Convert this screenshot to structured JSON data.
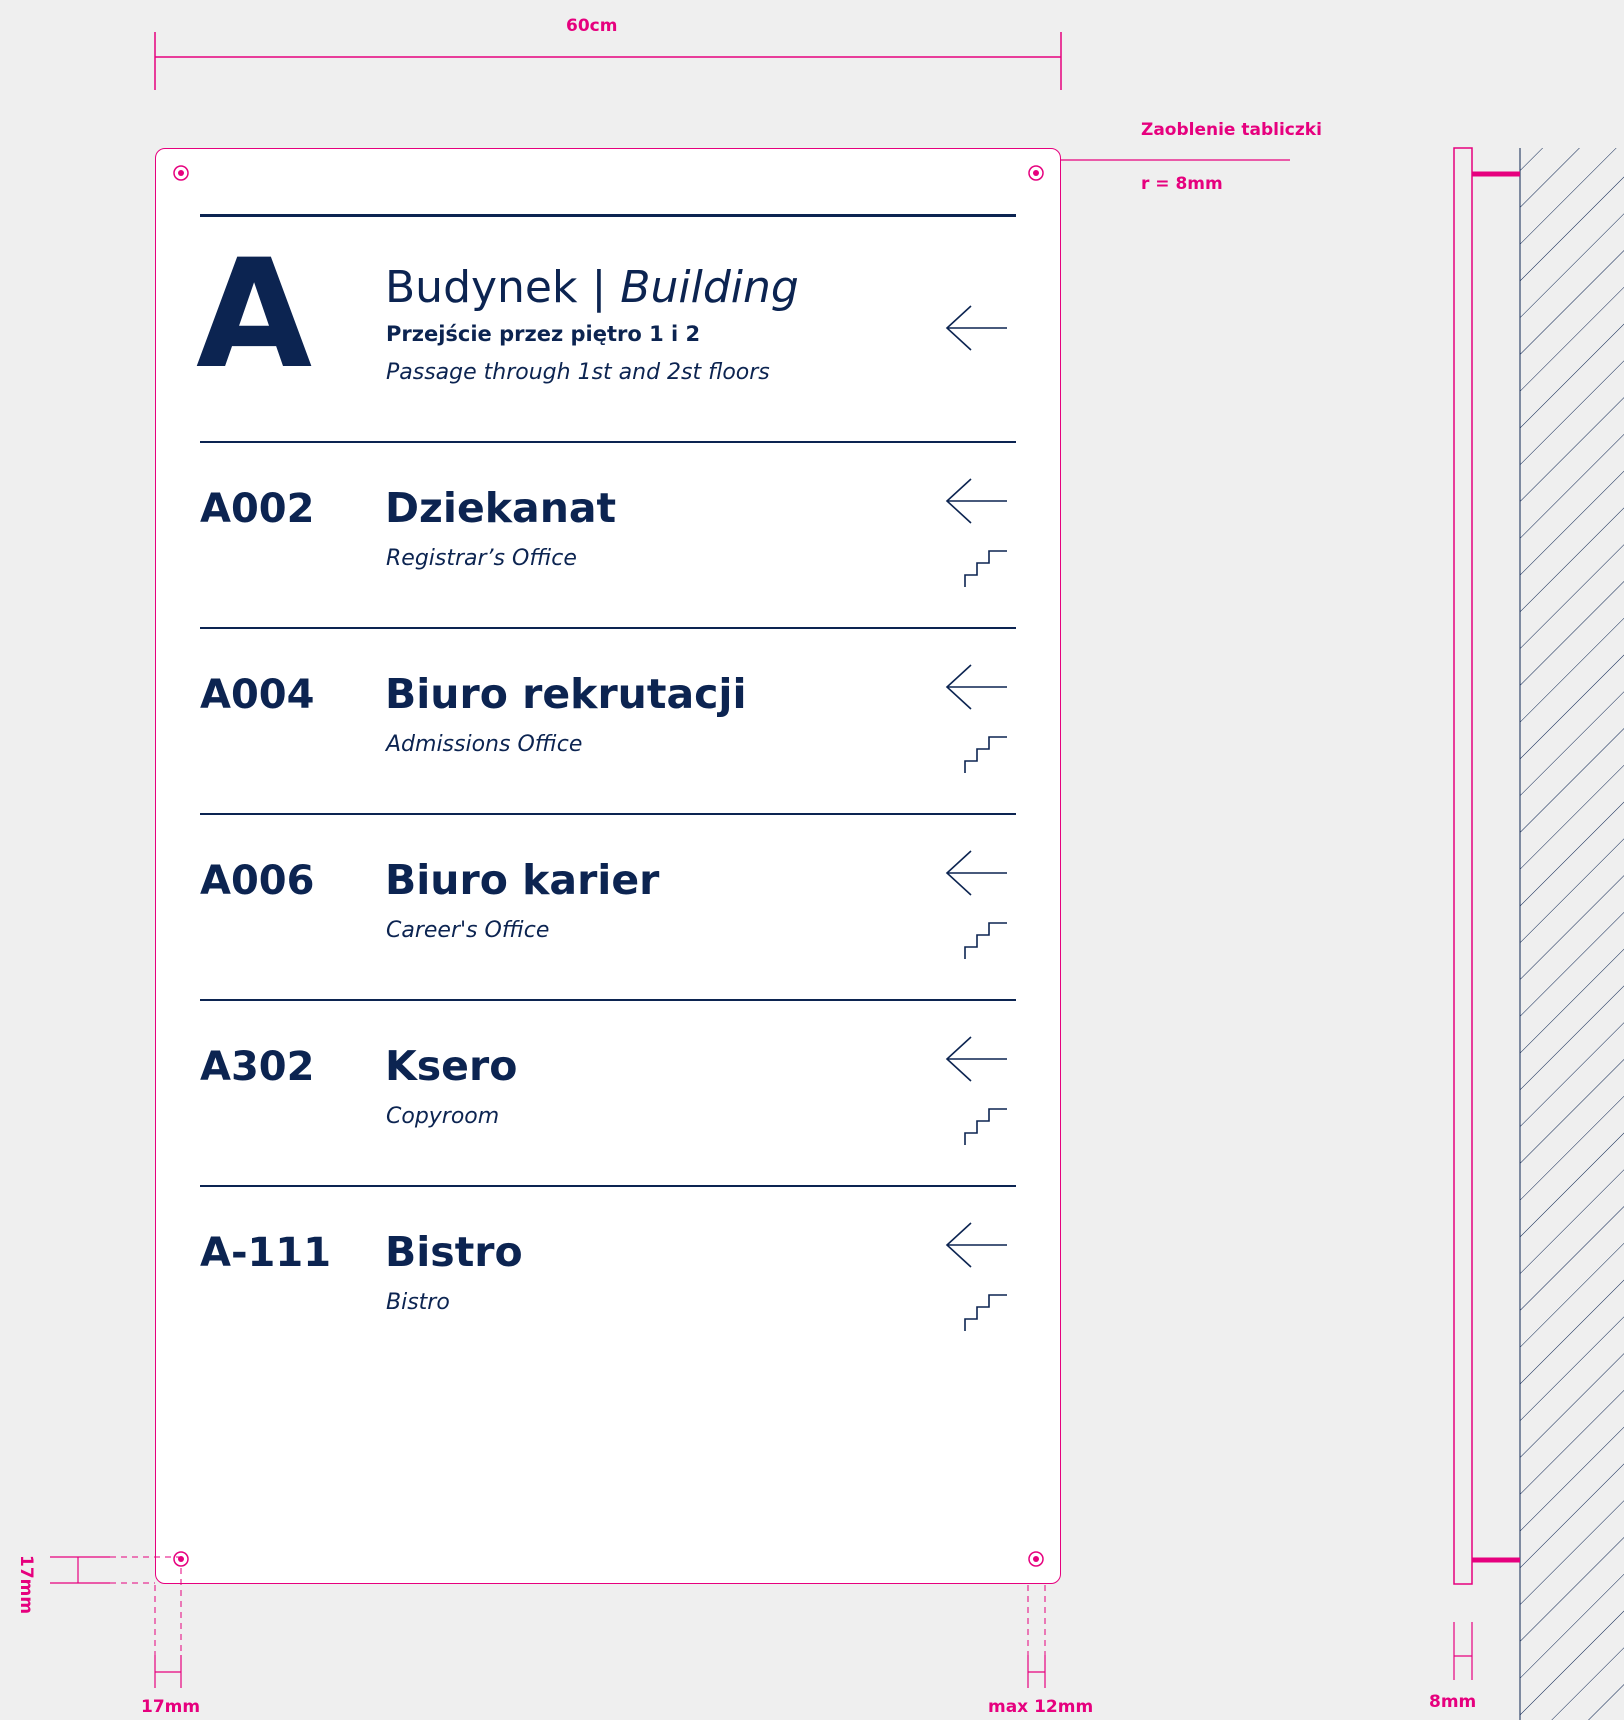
{
  "dimensions": {
    "width_label": "60cm",
    "corner_label": "Zaoblenie tabliczki",
    "corner_radius": "r = 8mm",
    "left_margin_horizontal": "17mm",
    "left_margin_vertical": "17mm",
    "right_margin": "max 12mm",
    "depth": "8mm"
  },
  "header": {
    "letter": "A",
    "title_pl": "Budynek |",
    "title_en": "Building",
    "line1": "Przejście przez piętro 1 i 2",
    "line2": "Passage through 1st and 2st floors"
  },
  "rows": [
    {
      "code": "A002",
      "title": "Dziekanat",
      "subtitle": "Registrar’s Office"
    },
    {
      "code": "A004",
      "title": "Biuro rekrutacji",
      "subtitle": "Admissions Office"
    },
    {
      "code": "A006",
      "title": "Biuro karier",
      "subtitle": "Career's Office"
    },
    {
      "code": "A302",
      "title": "Ksero",
      "subtitle": "Copyroom"
    },
    {
      "code": "A-111",
      "title": "Bistro",
      "subtitle": "Bistro"
    }
  ],
  "icons": {
    "arrow": "arrow-left-icon",
    "stairs": "stairs-icon",
    "screw": "screw-hole-icon"
  },
  "colors": {
    "navy": "#0c2451",
    "magenta": "#e6007e",
    "background": "#efefef",
    "plate": "#ffffff"
  }
}
